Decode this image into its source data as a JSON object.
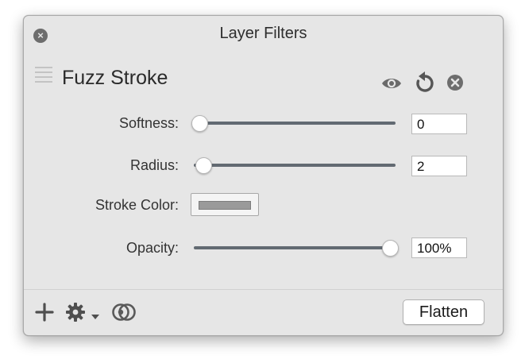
{
  "window": {
    "title": "Layer Filters",
    "close_glyph": "×"
  },
  "filter": {
    "name": "Fuzz Stroke",
    "icons": [
      "eye-icon",
      "reset-icon",
      "remove-filter-icon"
    ]
  },
  "controls": {
    "softness": {
      "label": "Softness:",
      "value": "0",
      "level": 0
    },
    "radius": {
      "label": "Radius:",
      "value": "2",
      "level": 0.02
    },
    "stroke_color": {
      "label": "Stroke Color:",
      "color": "#9a9a9a"
    },
    "opacity": {
      "label": "Opacity:",
      "value": "100%",
      "level": 1.0
    }
  },
  "bottom_bar": {
    "icons": [
      "add-icon",
      "gear-icon",
      "chevron-down-icon",
      "mask-icon"
    ],
    "flatten_label": "Flatten"
  },
  "colors": {
    "window_bg": "#e6e6e6",
    "slider_track": "#626a72"
  }
}
